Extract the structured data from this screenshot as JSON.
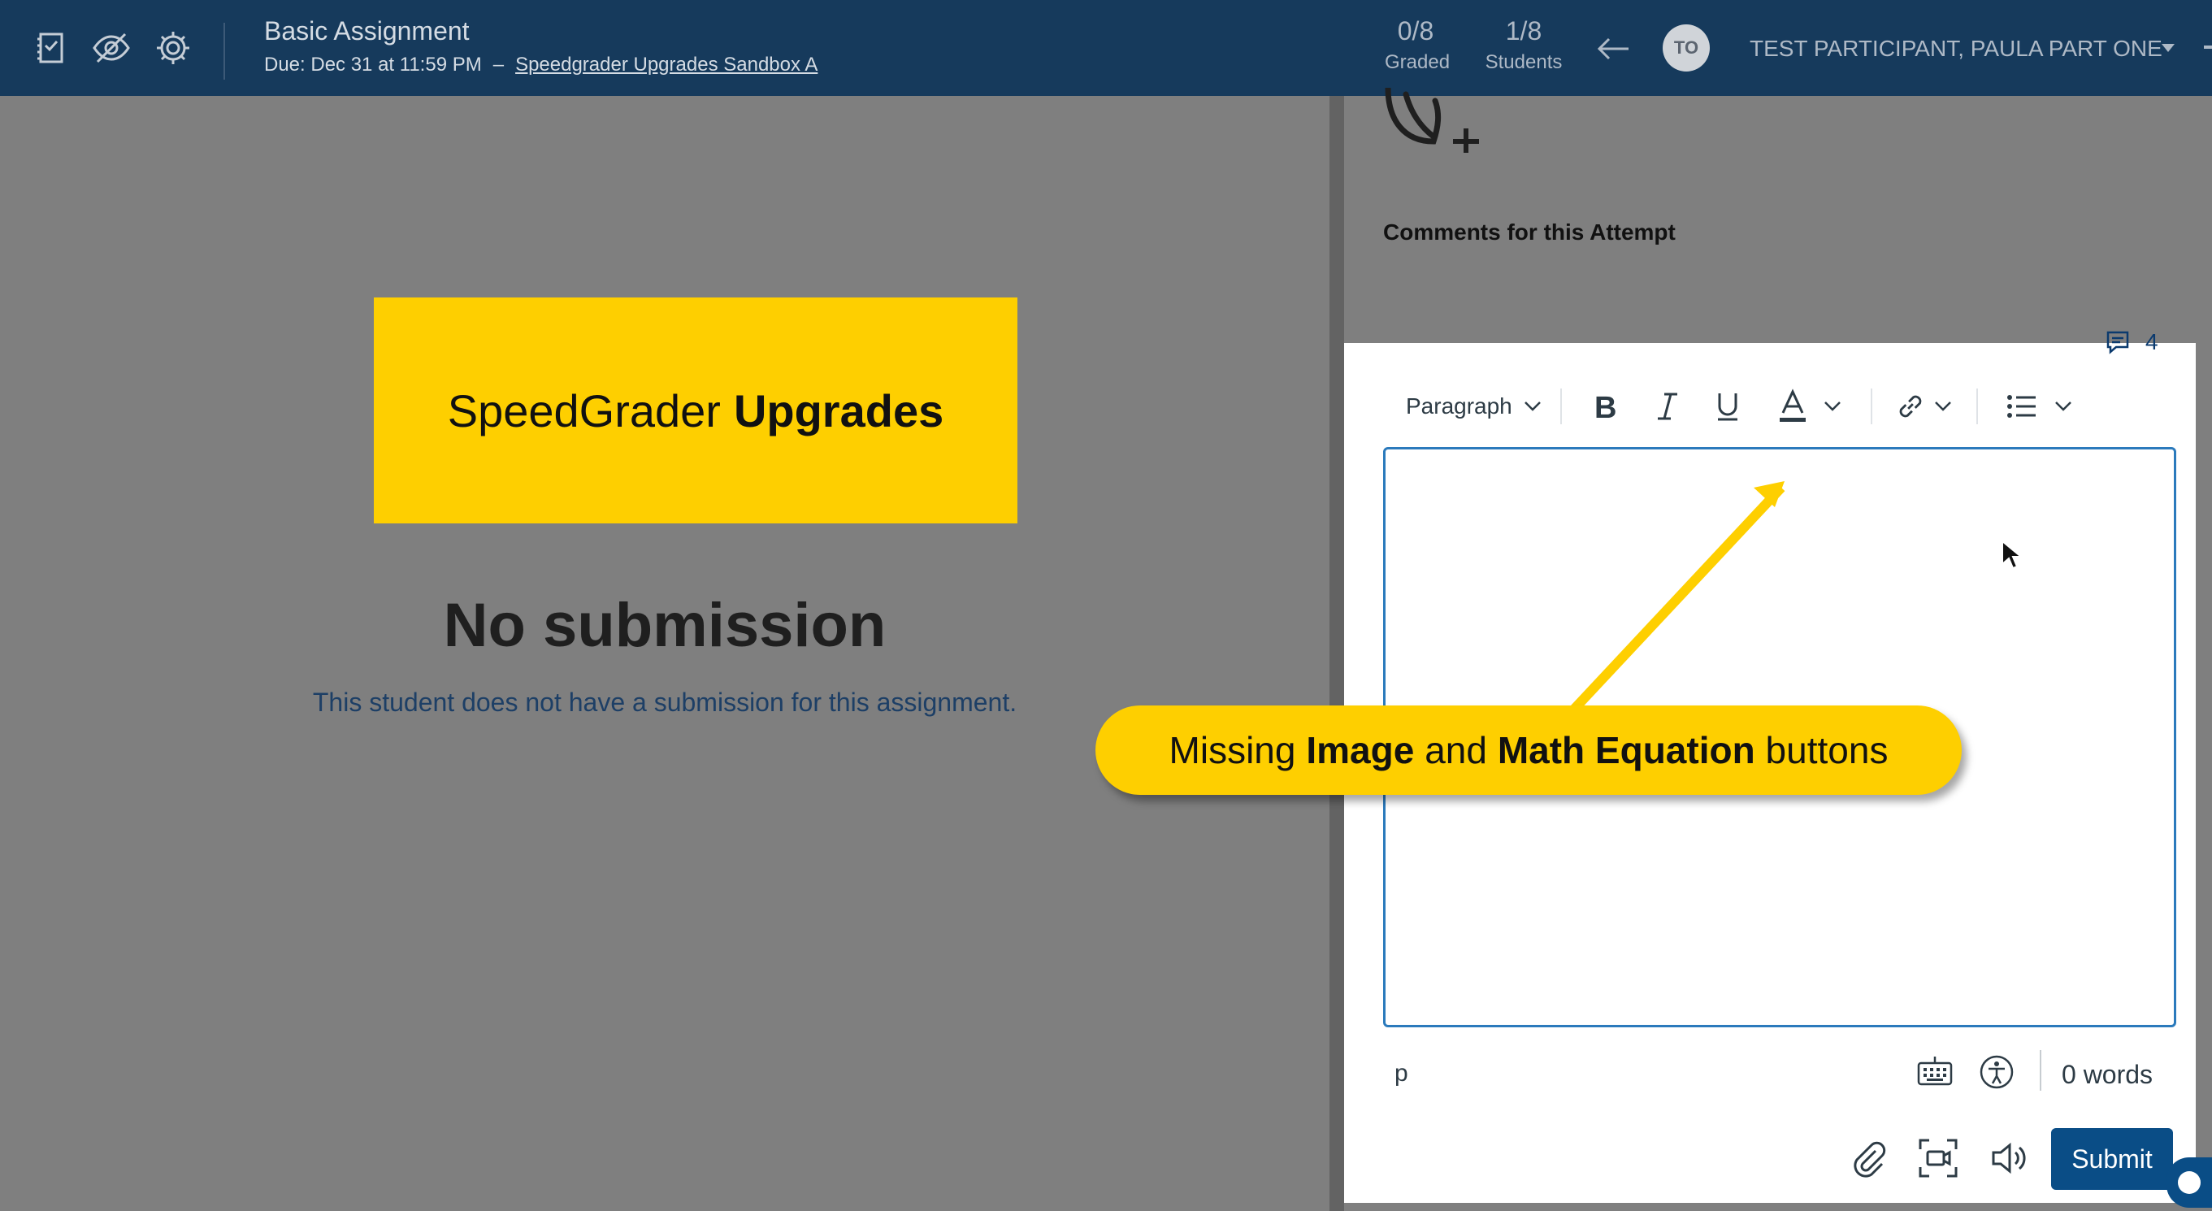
{
  "header": {
    "assignment_title": "Basic Assignment",
    "due": "Due: Dec 31 at 11:59 PM",
    "separator": "–",
    "course_link": "Speedgrader Upgrades Sandbox A",
    "graded_value": "0/8",
    "graded_label": "Graded",
    "students_value": "1/8",
    "students_label": "Students",
    "avatar_initials": "TO",
    "student_name": "TEST PARTICIPANT, PAULA PART ONE"
  },
  "left_pane": {
    "banner_text_regular": "SpeedGrader",
    "banner_text_bold": "Upgrades",
    "no_submission_title": "No submission",
    "no_submission_desc": "This student does not have a submission for this assignment."
  },
  "right_pane": {
    "comments_heading": "Comments for this Attempt",
    "comment_count": "4",
    "toolbar": {
      "block_format": "Paragraph",
      "icons": [
        "bold-icon",
        "italic-icon",
        "underline-icon",
        "text-color-icon",
        "link-icon",
        "bullet-list-icon"
      ]
    },
    "status_path": "p",
    "word_count": "0 words",
    "submit_label": "Submit"
  },
  "annotation": {
    "text_1": "Missing",
    "bold_1": "Image",
    "text_2": "and",
    "bold_2": "Math Equation",
    "text_3": "buttons"
  },
  "colors": {
    "header_bg": "#163a5c",
    "banner_yellow": "#fecf00",
    "editor_border": "#2b7abc",
    "submit_bg": "#0a4d86",
    "link_text": "#1d3f66"
  }
}
